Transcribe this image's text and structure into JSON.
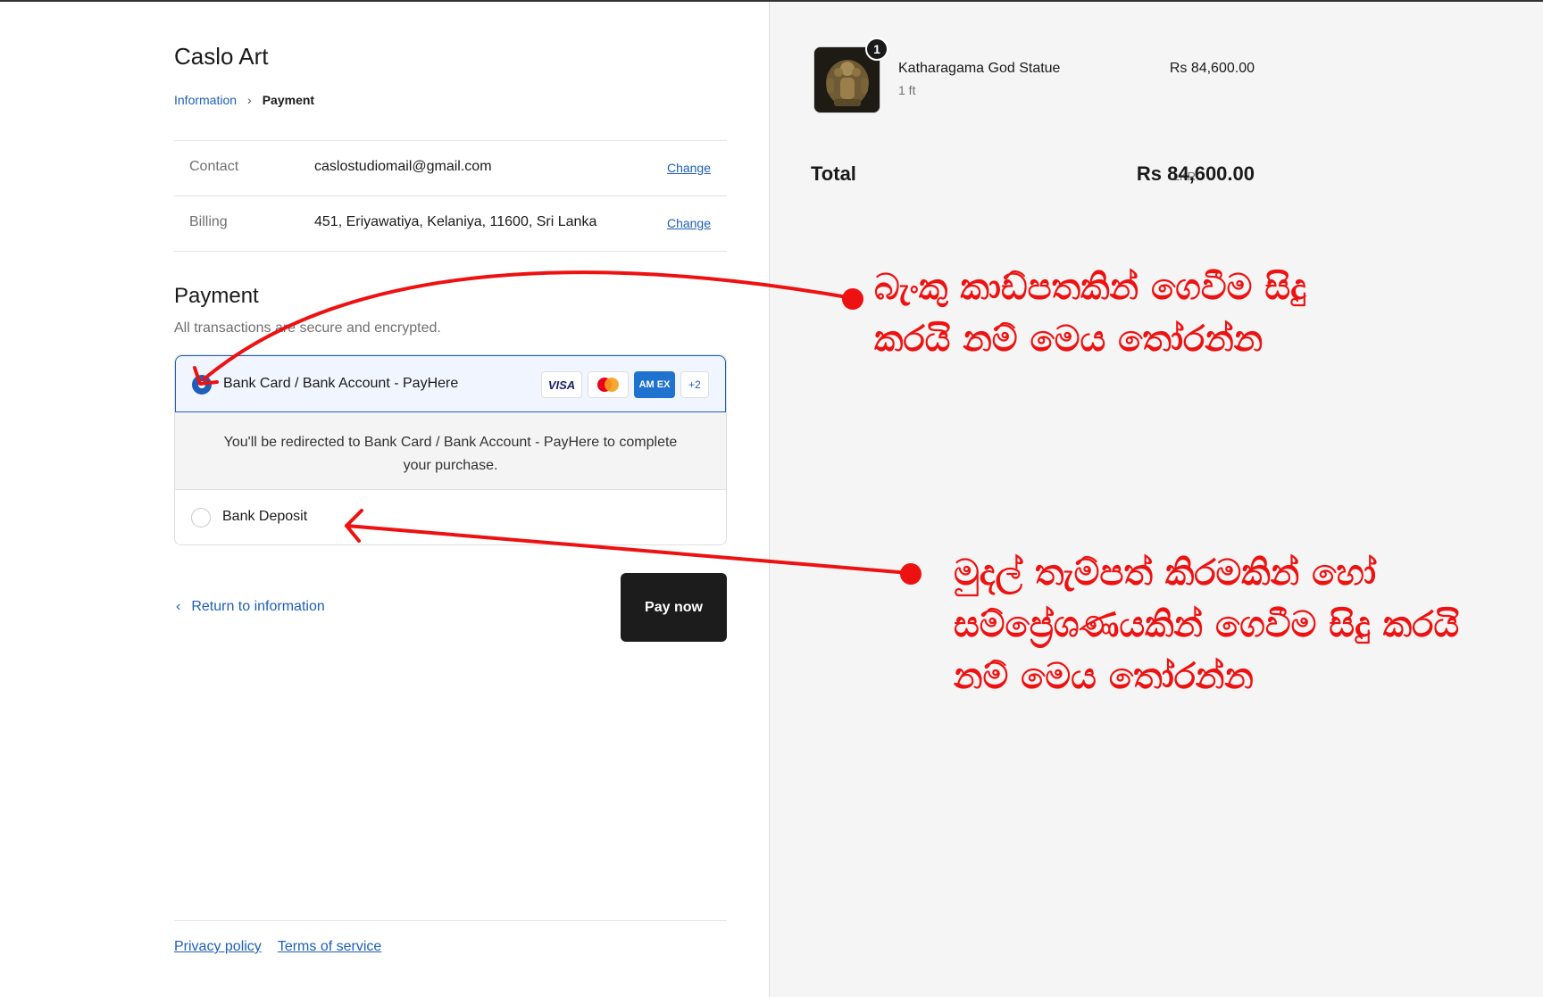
{
  "store": {
    "name": "Caslo Art"
  },
  "breadcrumb": {
    "step1": "Information",
    "step2": "Payment"
  },
  "review": {
    "contact_label": "Contact",
    "contact_value": "caslostudiomail@gmail.com",
    "billing_label": "Billing",
    "billing_value": "451, Eriyawatiya, Kelaniya, 11600, Sri Lanka",
    "change_label": "Change"
  },
  "payment": {
    "title": "Payment",
    "subtitle": "All transactions are secure and encrypted.",
    "method1_label": "Bank Card / Bank Account - PayHere",
    "method1_selected": true,
    "redirect_text": "You'll be redirected to Bank Card / Bank Account - PayHere to complete your purchase.",
    "method2_label": "Bank Deposit",
    "cards": {
      "visa": "VISA",
      "amex": "AM EX",
      "more": "+2"
    },
    "accent_color": "#1d5fb8"
  },
  "nav": {
    "return_label": "Return to information",
    "pay_label": "Pay now"
  },
  "footer": {
    "privacy": "Privacy policy",
    "terms": "Terms of service"
  },
  "order": {
    "item_name": "Katharagama God Statue",
    "item_variant": "1 ft",
    "item_price": "Rs 84,600.00",
    "item_qty": "1",
    "total_label": "Total",
    "total_currency": "LKR",
    "total_value": "Rs 84,600.00"
  },
  "annotations": {
    "note1_line1": "බැංකු කාඩ්පතකින් ගෙවීම සිදු",
    "note1_line2": "කරයි නම් මෙය තෝරන්න",
    "note2_line1": "මුදල් තැම්පත් කිරමකින් හෝ",
    "note2_line2": "සම්ප්‍රේශණයකින් ගෙවීම සිදු කරයි",
    "note2_line3": "නම් මෙය තෝරන්න",
    "color": "#ee1111"
  }
}
